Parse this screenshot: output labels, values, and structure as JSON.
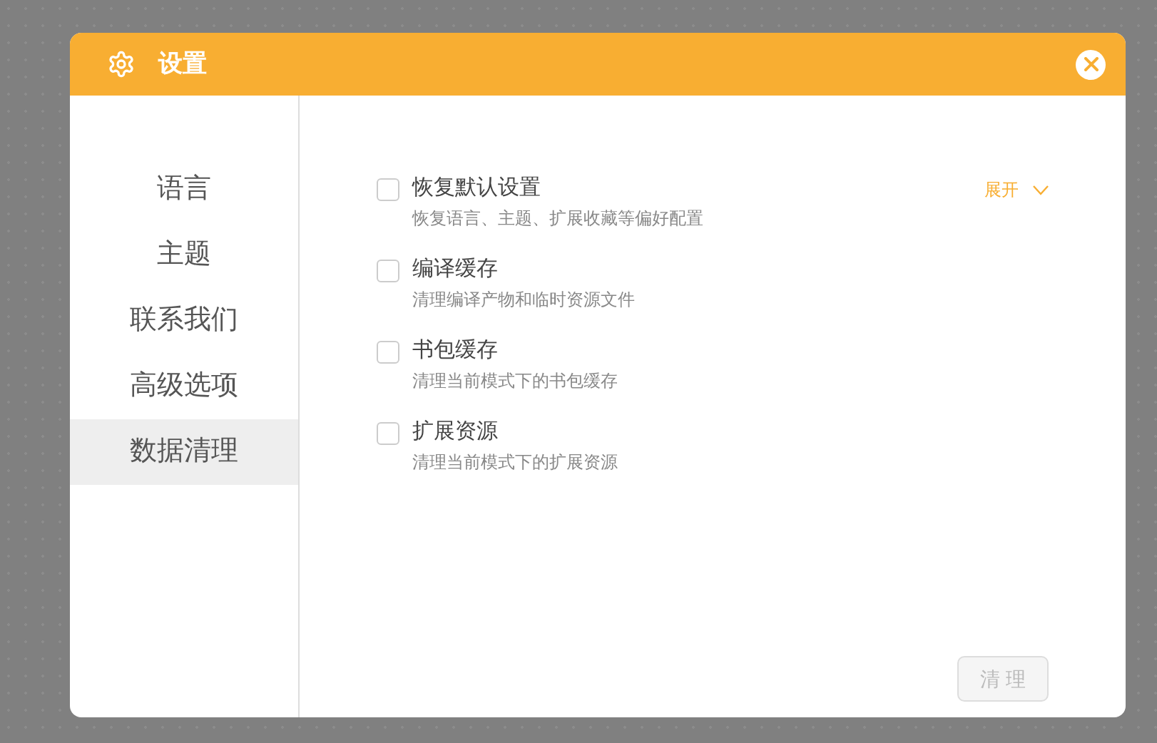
{
  "window": {
    "title": "设置"
  },
  "sidebar": {
    "items": [
      {
        "label": "语言",
        "selected": false
      },
      {
        "label": "主题",
        "selected": false
      },
      {
        "label": "联系我们",
        "selected": false
      },
      {
        "label": "高级选项",
        "selected": false
      },
      {
        "label": "数据清理",
        "selected": true
      }
    ]
  },
  "options": [
    {
      "title": "恢复默认设置",
      "description": "恢复语言、主题、扩展收藏等偏好配置",
      "checked": false,
      "expand": {
        "label": "展开",
        "expanded": false
      }
    },
    {
      "title": "编译缓存",
      "description": "清理编译产物和临时资源文件",
      "checked": false
    },
    {
      "title": "书包缓存",
      "description": "清理当前模式下的书包缓存",
      "checked": false
    },
    {
      "title": "扩展资源",
      "description": "清理当前模式下的扩展资源",
      "checked": false
    }
  ],
  "clear_button": {
    "label": "清 理",
    "disabled": true
  }
}
